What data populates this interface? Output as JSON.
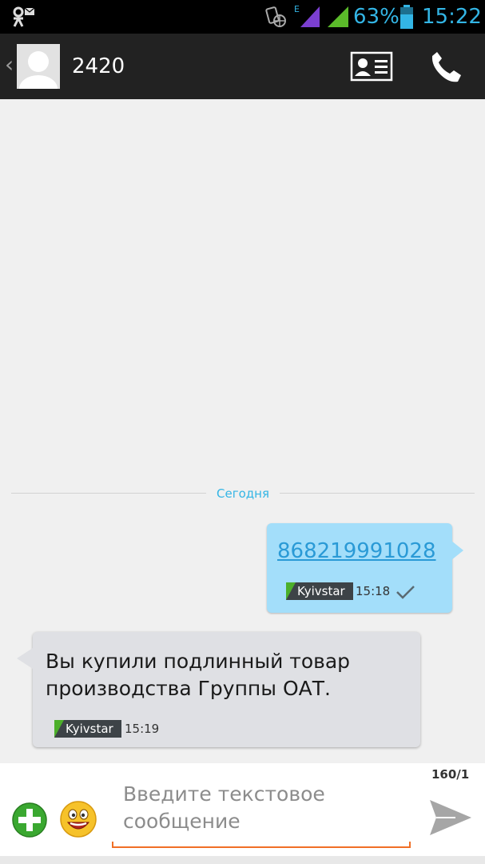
{
  "status_bar": {
    "network_type": "E",
    "battery_percent": "63%",
    "time": "15:22",
    "accent_color": "#33b5e5"
  },
  "header": {
    "contact_name": "2420",
    "icons": [
      "back-chevron-icon",
      "avatar-placeholder",
      "contact-card-icon",
      "phone-icon"
    ]
  },
  "conversation": {
    "date_label": "Сегодня",
    "messages": [
      {
        "direction": "outgoing",
        "text": "868219991028",
        "sim": "Kyivstar",
        "time": "15:18",
        "status": "delivered"
      },
      {
        "direction": "incoming",
        "text": "Вы купили подлинный товар производства Группы ОАТ.",
        "sim": "Kyivstar",
        "time": "15:19"
      }
    ]
  },
  "compose": {
    "char_counter": "160/1",
    "placeholder": "Введите текстовое сообщение"
  }
}
